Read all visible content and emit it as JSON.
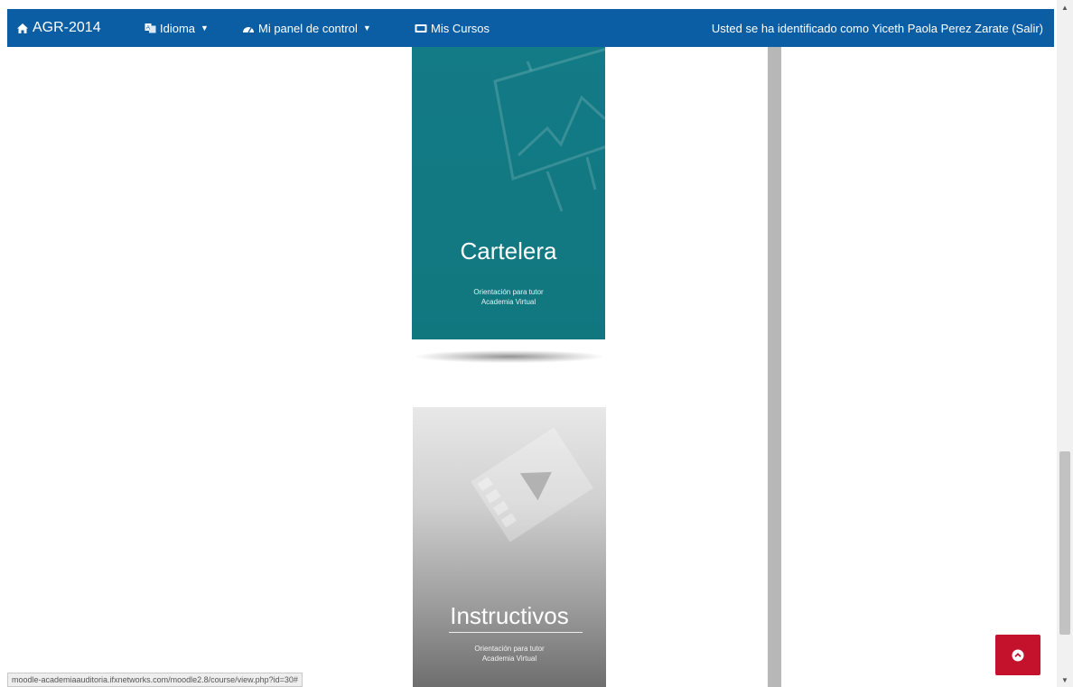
{
  "navbar": {
    "brand": "AGR-2014",
    "language_label": "Idioma",
    "dashboard_label": "Mi panel de control",
    "courses_label": "Mis Cursos",
    "user_text": "Usted se ha identificado como Yiceth Paola Perez Zarate (Salir)",
    "background": "#0b5ea3"
  },
  "cards": {
    "cartelera": {
      "title": "Cartelera",
      "subtitle_line1": "Orientación para tutor",
      "subtitle_line2": "Academia Virtual",
      "color": "#137b86"
    },
    "instructivos": {
      "title": "Instructivos",
      "subtitle_line1": "Orientación para tutor",
      "subtitle_line2": "Academia Virtual"
    }
  },
  "status_bar": {
    "url": "moodle-academiaauditoria.ifxnetworks.com/moodle2.8/course/view.php?id=30#"
  },
  "scroll_top_button": {
    "icon": "chevron-up-circle-icon",
    "color": "#c4122d"
  },
  "icons": {
    "home": "home-icon",
    "language": "language-icon",
    "dashboard": "dashboard-icon",
    "courses": "courses-icon",
    "cartelera": "presentation-board-icon",
    "instructivos": "film-strip-icon"
  }
}
